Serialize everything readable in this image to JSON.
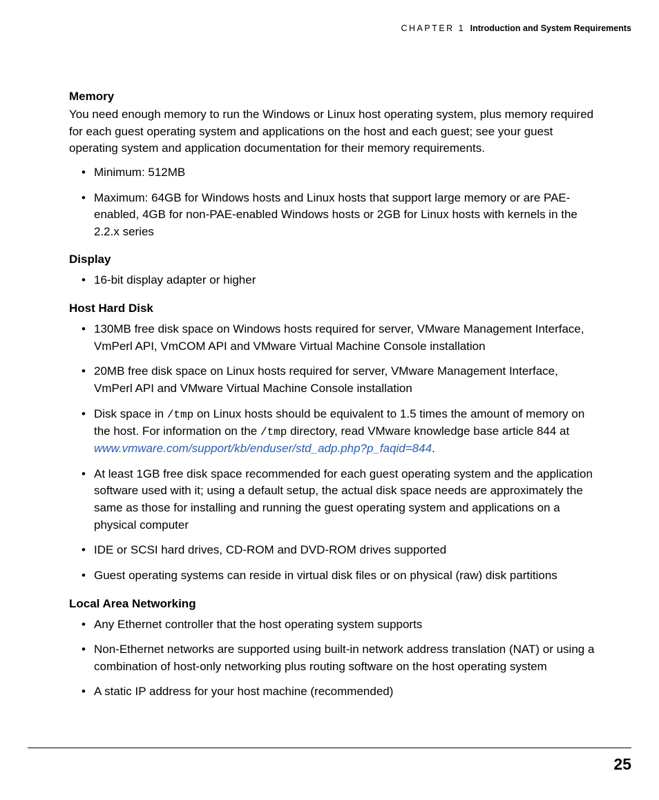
{
  "header": {
    "chapter_label": "CHAPTER 1",
    "chapter_title": "Introduction and System Requirements"
  },
  "sections": {
    "memory": {
      "heading": "Memory",
      "paragraph": "You need enough memory to run the Windows or Linux host operating system, plus memory required for each guest operating system and applications on the host and each guest; see your guest operating system and application documentation for their memory requirements.",
      "bullets": [
        "Minimum: 512MB",
        "Maximum: 64GB for Windows hosts and Linux hosts that support large memory or are PAE-enabled, 4GB for non-PAE-enabled Windows hosts or 2GB for Linux hosts with kernels in the 2.2.x series"
      ]
    },
    "display": {
      "heading": "Display",
      "bullets": [
        "16-bit display adapter or higher"
      ]
    },
    "host_hard_disk": {
      "heading": "Host Hard Disk",
      "bullet_0": "130MB free disk space on Windows hosts required for server, VMware Management Interface, VmPerl API, VmCOM API and VMware Virtual Machine Console installation",
      "bullet_1": "20MB free disk space on Linux hosts required for server, VMware Management Interface, VmPerl API and VMware Virtual Machine Console installation",
      "bullet_2_pre": "Disk space in ",
      "bullet_2_tmp1": "/tmp",
      "bullet_2_mid": " on Linux hosts should be equivalent to 1.5 times the amount of memory on the host. For information on the ",
      "bullet_2_tmp2": "/tmp",
      "bullet_2_post": " directory, read VMware knowledge base article 844 at ",
      "bullet_2_link": "www.vmware.com/support/kb/enduser/std_adp.php?p_faqid=844",
      "bullet_2_end": ".",
      "bullet_3": "At least 1GB free disk space recommended for each guest operating system and the application software used with it; using a default setup, the actual disk space needs are approximately the same as those for installing and running the guest operating system and applications on a physical computer",
      "bullet_4": "IDE or SCSI hard drives, CD-ROM and DVD-ROM drives supported",
      "bullet_5": "Guest operating systems can reside in virtual disk files or on physical (raw) disk partitions"
    },
    "lan": {
      "heading": "Local Area Networking",
      "bullets": [
        "Any Ethernet controller that the host operating system supports",
        "Non-Ethernet networks are supported using built-in network address translation (NAT) or using a combination of host-only networking plus routing software on the host operating system",
        "A static IP address for your host machine (recommended)"
      ]
    }
  },
  "page_number": "25"
}
